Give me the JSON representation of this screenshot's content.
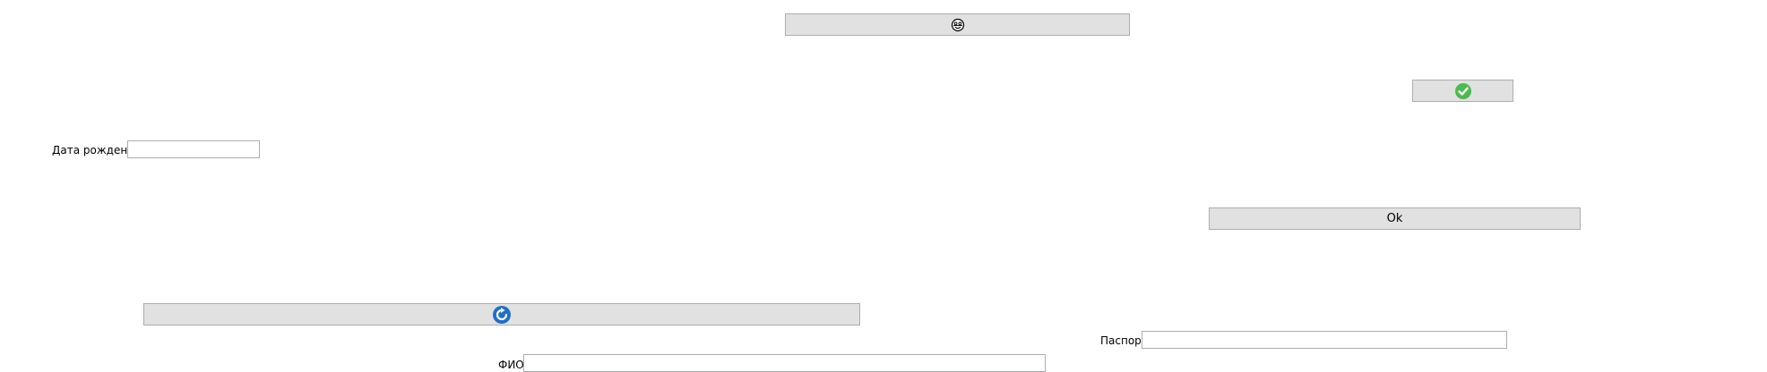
{
  "buttons": {
    "face": {
      "icon": "smiley-face-icon"
    },
    "confirm": {
      "icon": "green-checkmark-icon",
      "color": "#4cbb4f"
    },
    "ok": {
      "label": "Ok"
    },
    "refresh": {
      "icon": "blue-refresh-icon",
      "color": "#1e6fc9"
    }
  },
  "fields": {
    "birth_date": {
      "label": "Дата рождения",
      "value": ""
    },
    "passport": {
      "label": "Паспорт",
      "value": ""
    },
    "full_name": {
      "label": "ФИО",
      "value": ""
    }
  }
}
